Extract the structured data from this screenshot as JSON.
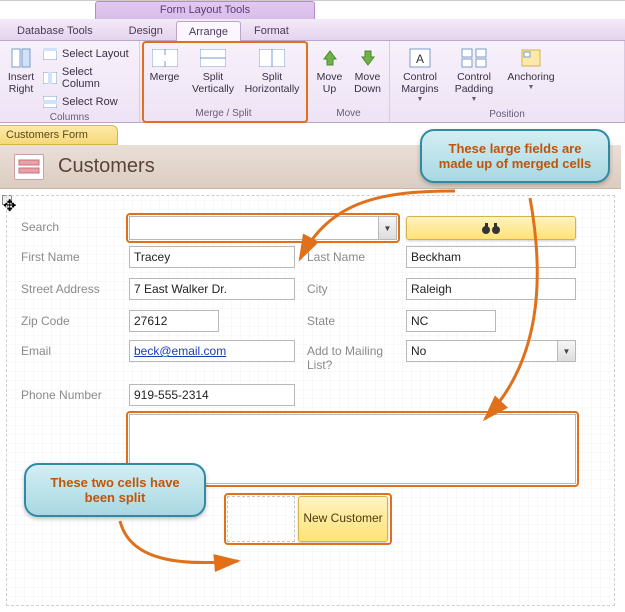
{
  "title_tab": "Form Layout Tools",
  "tabs": {
    "db": "Database Tools",
    "design": "Design",
    "arrange": "Arrange",
    "format": "Format"
  },
  "ribbon": {
    "columns": {
      "insert_right": "Insert\nRight",
      "select_layout": "Select Layout",
      "select_column": "Select Column",
      "select_row": "Select Row",
      "cap": "Columns"
    },
    "merge": {
      "merge": "Merge",
      "split_v": "Split\nVertically",
      "split_h": "Split\nHorizontally",
      "cap": "Merge / Split"
    },
    "move": {
      "up": "Move\nUp",
      "down": "Move\nDown",
      "cap": "Move"
    },
    "position": {
      "margins": "Control\nMargins",
      "padding": "Control\nPadding",
      "anchoring": "Anchoring",
      "cap": "Position"
    }
  },
  "doc_tab": "Customers Form",
  "form": {
    "title": "Customers",
    "labels": {
      "search": "Search",
      "first": "First Name",
      "last": "Last Name",
      "street": "Street Address",
      "city": "City",
      "zip": "Zip Code",
      "state": "State",
      "email": "Email",
      "mailing": "Add to Mailing List?",
      "phone": "Phone Number"
    },
    "values": {
      "search": "",
      "first": "Tracey",
      "last": "Beckham",
      "street": "7 East Walker Dr.",
      "city": "Raleigh",
      "zip": "27612",
      "state": "NC",
      "email": "beck@email.com",
      "mailing": "No",
      "phone": "919-555-2314"
    },
    "buttons": {
      "new": "New Customer"
    }
  },
  "callouts": {
    "merged": "These large fields are made up of merged cells",
    "split": "These two cells have been split"
  }
}
